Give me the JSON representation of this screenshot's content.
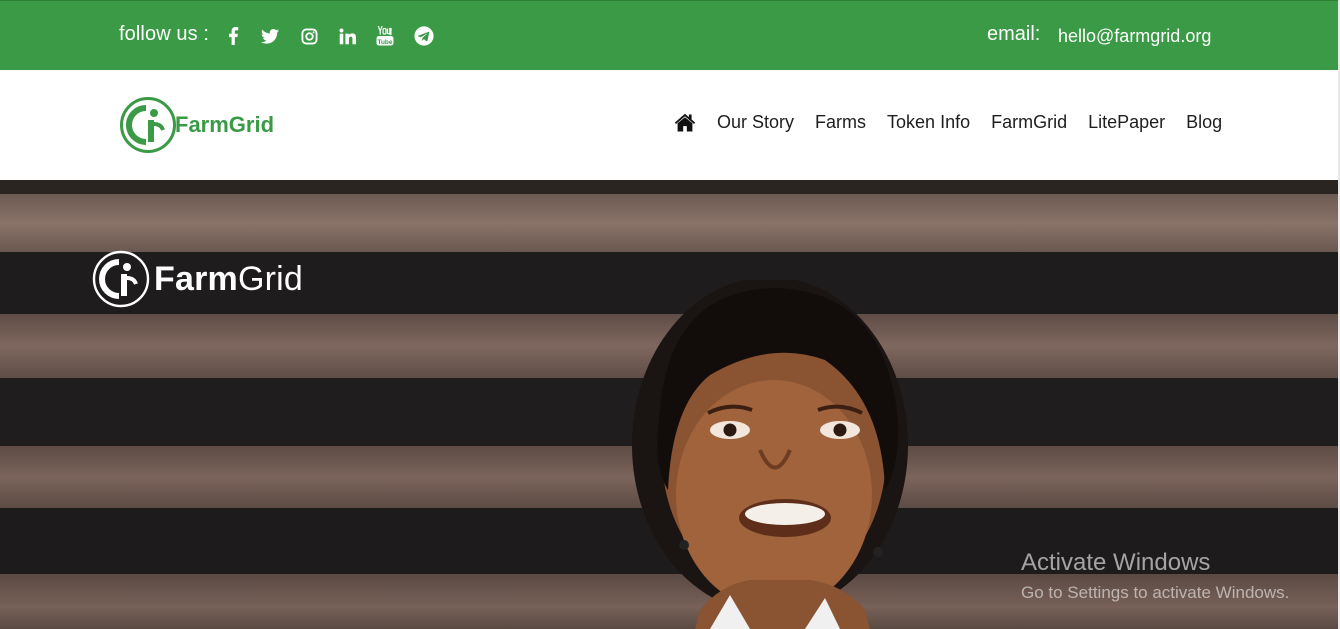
{
  "topbar": {
    "follow_label": "follow us :",
    "social_icons": [
      "facebook-icon",
      "twitter-icon",
      "instagram-icon",
      "linkedin-icon",
      "youtube-icon",
      "telegram-icon"
    ],
    "email_label": "email:",
    "email_value": "hello@farmgrid.org",
    "background_color": "#3a9a45"
  },
  "header": {
    "logo_text": "FarmGrid",
    "brand_color": "#3a9a45",
    "nav": {
      "home_icon": "home-icon",
      "items": [
        "Our Story",
        "Farms",
        "Token Info",
        "FarmGrid",
        "LitePaper",
        "Blog"
      ]
    }
  },
  "hero": {
    "logo_text_bold": "Farm",
    "logo_text_light": "Grid"
  },
  "os_watermark": {
    "title": "Activate Windows",
    "subtitle": "Go to Settings to activate Windows."
  }
}
